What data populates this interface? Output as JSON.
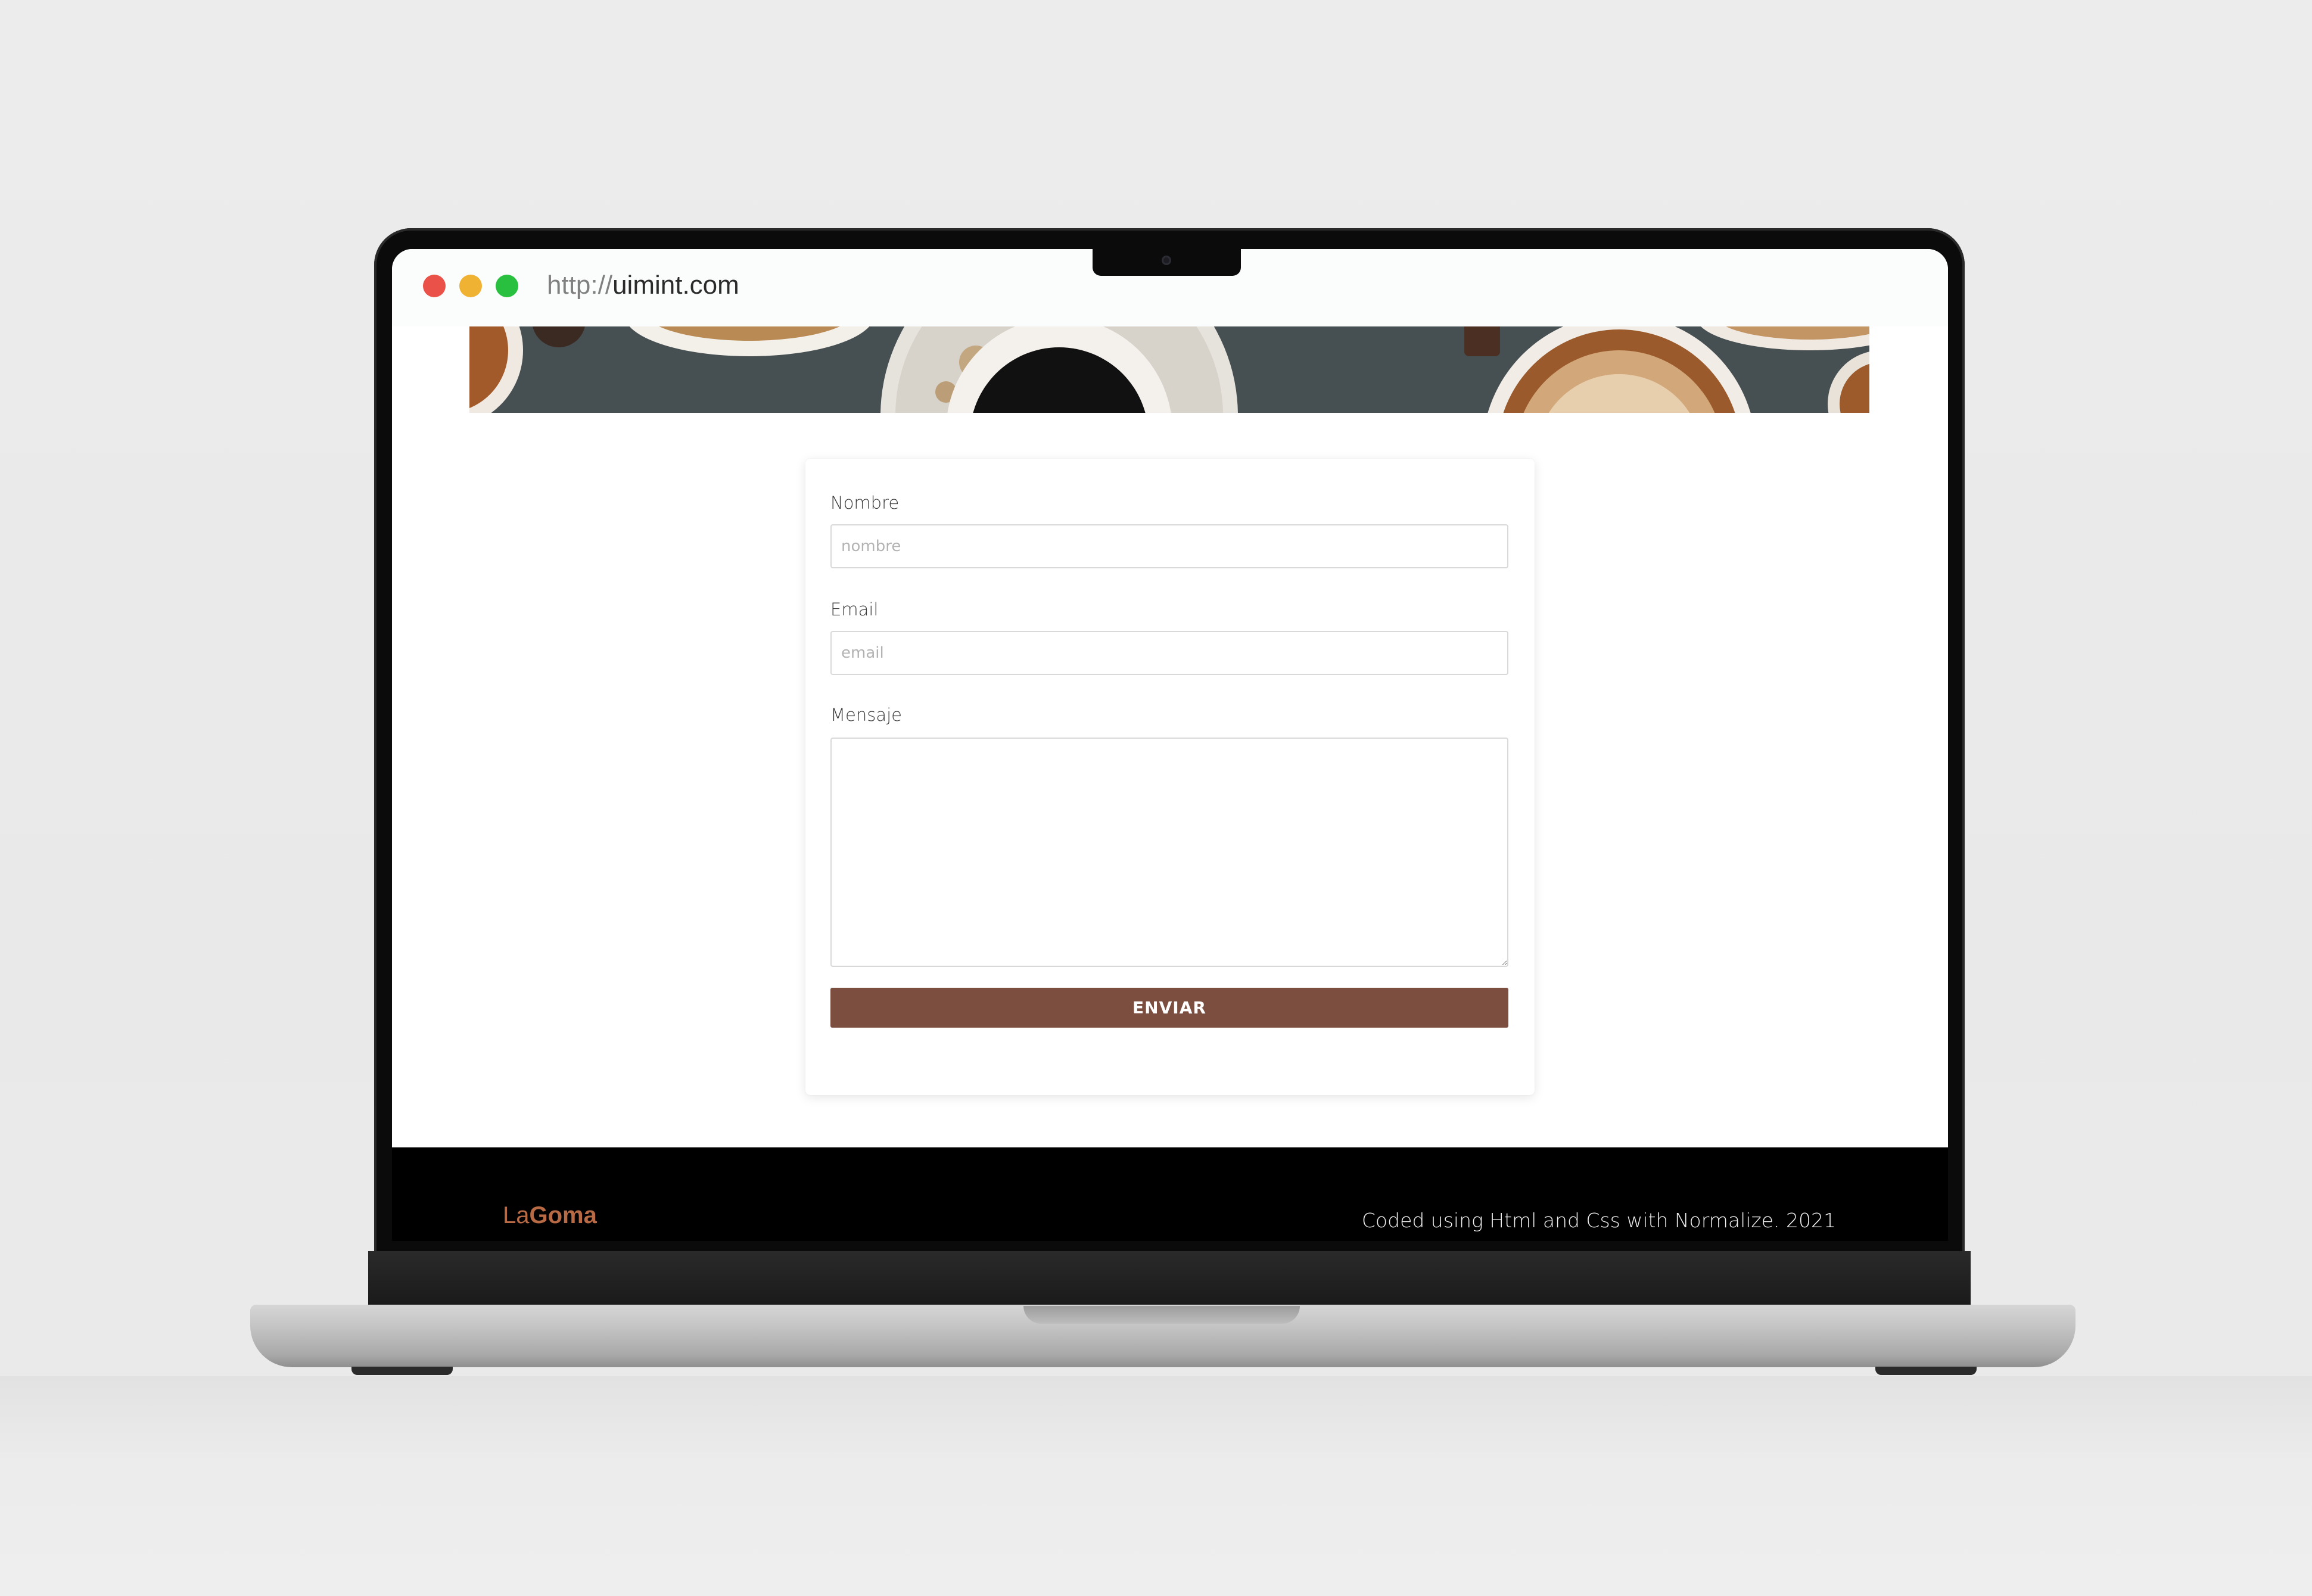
{
  "browser": {
    "url_protocol": "http://",
    "url_host": "uimint.com"
  },
  "form": {
    "name_label": "Nombre",
    "name_placeholder": "nombre",
    "email_label": "Email",
    "email_placeholder": "email",
    "message_label": "Mensaje",
    "submit_label": "ENVIAR"
  },
  "footer": {
    "brand_prefix": "La",
    "brand_suffix": "Goma",
    "credit": "Coded using Html and Css with Normalize. 2021"
  },
  "colors": {
    "button": "#7b4e40",
    "brand": "#b76a44",
    "footer_bg": "#000000"
  }
}
